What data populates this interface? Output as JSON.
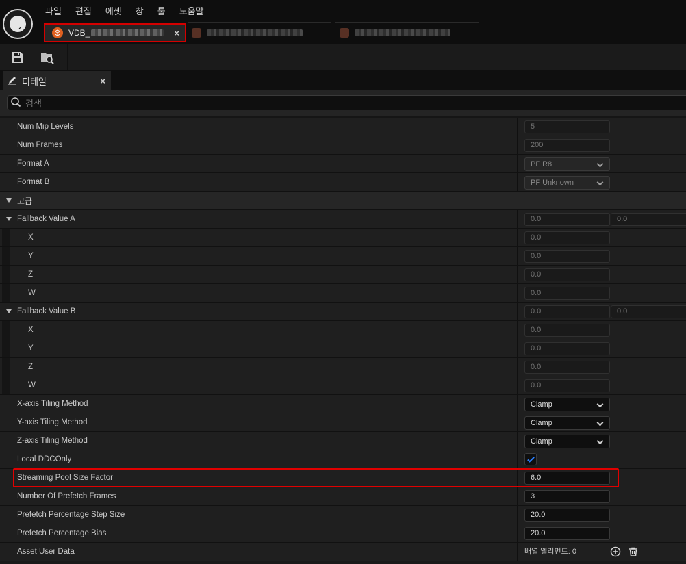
{
  "menu": [
    "파일",
    "편집",
    "에셋",
    "창",
    "툴",
    "도움말"
  ],
  "active_tab": {
    "label": "VDB_"
  },
  "panel": {
    "label": "디테일"
  },
  "search": {
    "placeholder": "검색"
  },
  "properties": [
    {
      "name": "Num Mip Levels",
      "kind": "field",
      "readonly": true,
      "value": "5"
    },
    {
      "name": "Num Frames",
      "kind": "field",
      "readonly": true,
      "value": "200"
    },
    {
      "name": "Format A",
      "kind": "combo",
      "readonly": true,
      "value": "PF R8"
    },
    {
      "name": "Format B",
      "kind": "combo",
      "readonly": true,
      "value": "PF Unknown"
    },
    {
      "name": "고급",
      "kind": "category"
    },
    {
      "name": "Fallback Value A",
      "kind": "vector",
      "expanded": true,
      "values": [
        "0.0",
        "0.0"
      ]
    },
    {
      "name": "X",
      "kind": "field",
      "child": true,
      "readonly": true,
      "value": "0.0"
    },
    {
      "name": "Y",
      "kind": "field",
      "child": true,
      "readonly": true,
      "value": "0.0"
    },
    {
      "name": "Z",
      "kind": "field",
      "child": true,
      "readonly": true,
      "value": "0.0"
    },
    {
      "name": "W",
      "kind": "field",
      "child": true,
      "readonly": true,
      "value": "0.0"
    },
    {
      "name": "Fallback Value B",
      "kind": "vector",
      "expanded": true,
      "values": [
        "0.0",
        "0.0"
      ]
    },
    {
      "name": "X",
      "kind": "field",
      "child": true,
      "readonly": true,
      "value": "0.0"
    },
    {
      "name": "Y",
      "kind": "field",
      "child": true,
      "readonly": true,
      "value": "0.0"
    },
    {
      "name": "Z",
      "kind": "field",
      "child": true,
      "readonly": true,
      "value": "0.0"
    },
    {
      "name": "W",
      "kind": "field",
      "child": true,
      "readonly": true,
      "value": "0.0"
    },
    {
      "name": "X-axis Tiling Method",
      "kind": "combo",
      "value": "Clamp"
    },
    {
      "name": "Y-axis Tiling Method",
      "kind": "combo",
      "value": "Clamp"
    },
    {
      "name": "Z-axis Tiling Method",
      "kind": "combo",
      "value": "Clamp"
    },
    {
      "name": "Local DDCOnly",
      "kind": "checkbox",
      "checked": true
    },
    {
      "name": "Streaming Pool Size Factor",
      "kind": "field",
      "value": "6.0",
      "highlighted": true
    },
    {
      "name": "Number Of Prefetch Frames",
      "kind": "field",
      "value": "3"
    },
    {
      "name": "Prefetch Percentage Step Size",
      "kind": "field",
      "value": "20.0"
    },
    {
      "name": "Prefetch Percentage Bias",
      "kind": "field",
      "value": "20.0"
    },
    {
      "name": "Asset User Data",
      "kind": "array",
      "value": "배열 엘리먼트: 0"
    }
  ],
  "icons": {
    "save": "save-icon",
    "browse": "browse-asset-icon",
    "panel": "details-pencil-icon",
    "search": "search-icon",
    "add": "add-element-icon",
    "delete": "delete-all-icon"
  },
  "colors": {
    "highlight": "#e00000",
    "checkbox_check": "#2a7fff",
    "asset_icon": "#e06020"
  }
}
